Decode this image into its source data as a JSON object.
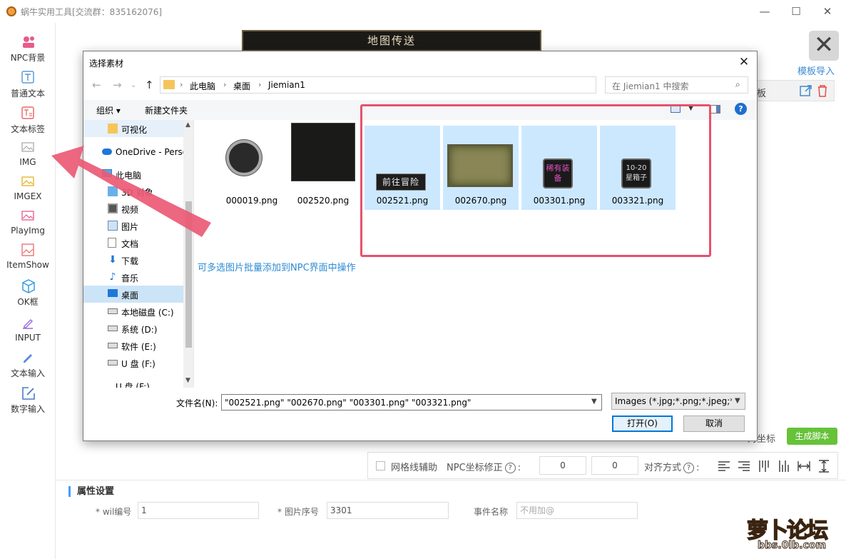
{
  "app": {
    "title": "蜗牛实用工具[交流群：835162076]",
    "window_controls": [
      "—",
      "☐",
      "✕"
    ]
  },
  "sidebar": {
    "items": [
      {
        "label": "NPC背景",
        "icon": "npc-background-icon"
      },
      {
        "label": "普通文本",
        "icon": "text-icon"
      },
      {
        "label": "文本标签",
        "icon": "text-label-icon"
      },
      {
        "label": "IMG",
        "icon": "image-icon"
      },
      {
        "label": "IMGEX",
        "icon": "image-ex-icon"
      },
      {
        "label": "PlayImg",
        "icon": "play-image-icon"
      },
      {
        "label": "ItemShow",
        "icon": "item-show-icon"
      },
      {
        "label": "OK框",
        "icon": "cube-icon"
      },
      {
        "label": "INPUT",
        "icon": "input-icon"
      },
      {
        "label": "文本输入",
        "icon": "pencil-icon"
      },
      {
        "label": "数字输入",
        "icon": "edit-box-icon"
      }
    ]
  },
  "canvas": {
    "preview_title": "地图传送",
    "close_glyph": "✕",
    "template_import": "模板导入",
    "right_panel_label": "板",
    "coord_label": "对坐标",
    "generate_button": "生成脚本"
  },
  "grid_bar": {
    "grid_assist": "网格线辅助",
    "npc_coord_fix": "NPC坐标修正",
    "help_glyph": "?",
    "colon": ":",
    "x_value": "0",
    "y_value": "0",
    "align_label": "对齐方式"
  },
  "props": {
    "title": "属性设置",
    "wil_label": "* wil编号",
    "wil_value": "1",
    "img_index_label": "* 图片序号",
    "img_index_value": "3301",
    "event_label": "事件名称",
    "event_placeholder": "不用加@"
  },
  "watermark": {
    "text": "萝卜论坛",
    "url": "bbs.0lb.com"
  },
  "dialog": {
    "title": "选择素材",
    "close_glyph": "✕",
    "breadcrumb": [
      "此电脑",
      "桌面",
      "Jiemian1"
    ],
    "search_placeholder": "在 Jiemian1 中搜索",
    "toolbar": {
      "organize": "组织 ▾",
      "new_folder": "新建文件夹"
    },
    "nav_items": [
      {
        "label": "可视化",
        "icon": "folder-icon"
      },
      {
        "label": "OneDrive - Perso",
        "icon": "cloud-icon"
      },
      {
        "label": "此电脑",
        "icon": "computer-icon"
      },
      {
        "label": "3D 对象",
        "icon": "3d-objects-icon"
      },
      {
        "label": "视频",
        "icon": "video-icon"
      },
      {
        "label": "图片",
        "icon": "pictures-icon"
      },
      {
        "label": "文档",
        "icon": "documents-icon"
      },
      {
        "label": "下载",
        "icon": "download-icon"
      },
      {
        "label": "音乐",
        "icon": "music-icon"
      },
      {
        "label": "桌面",
        "icon": "desktop-icon"
      },
      {
        "label": "本地磁盘 (C:)",
        "icon": "drive-c-icon"
      },
      {
        "label": "系统 (D:)",
        "icon": "drive-icon"
      },
      {
        "label": "软件 (E:)",
        "icon": "drive-icon"
      },
      {
        "label": "U 盘 (F:)",
        "icon": "usb-drive-icon"
      },
      {
        "label": "U 盘 (F:)",
        "icon": "usb-drive-icon"
      }
    ],
    "files": [
      {
        "name": "000019.png",
        "selected": false
      },
      {
        "name": "002520.png",
        "selected": false
      },
      {
        "name": "002521.png",
        "selected": true,
        "thumb_text": "前往冒险"
      },
      {
        "name": "002670.png",
        "selected": true
      },
      {
        "name": "003301.png",
        "selected": true,
        "thumb_text": "稀有装备"
      },
      {
        "name": "003321.png",
        "selected": true,
        "thumb_text": "10-20星箱子"
      }
    ],
    "hint": "可多选图片批量添加到NPC界面中操作",
    "filename_label": "文件名(N):",
    "filename_value": "\"002521.png\" \"002670.png\" \"003301.png\" \"003321.png\"",
    "file_type": "Images (*.jpg;*.png;*.jpeg;*.g",
    "open_button": "打开(O)",
    "cancel_button": "取消"
  }
}
